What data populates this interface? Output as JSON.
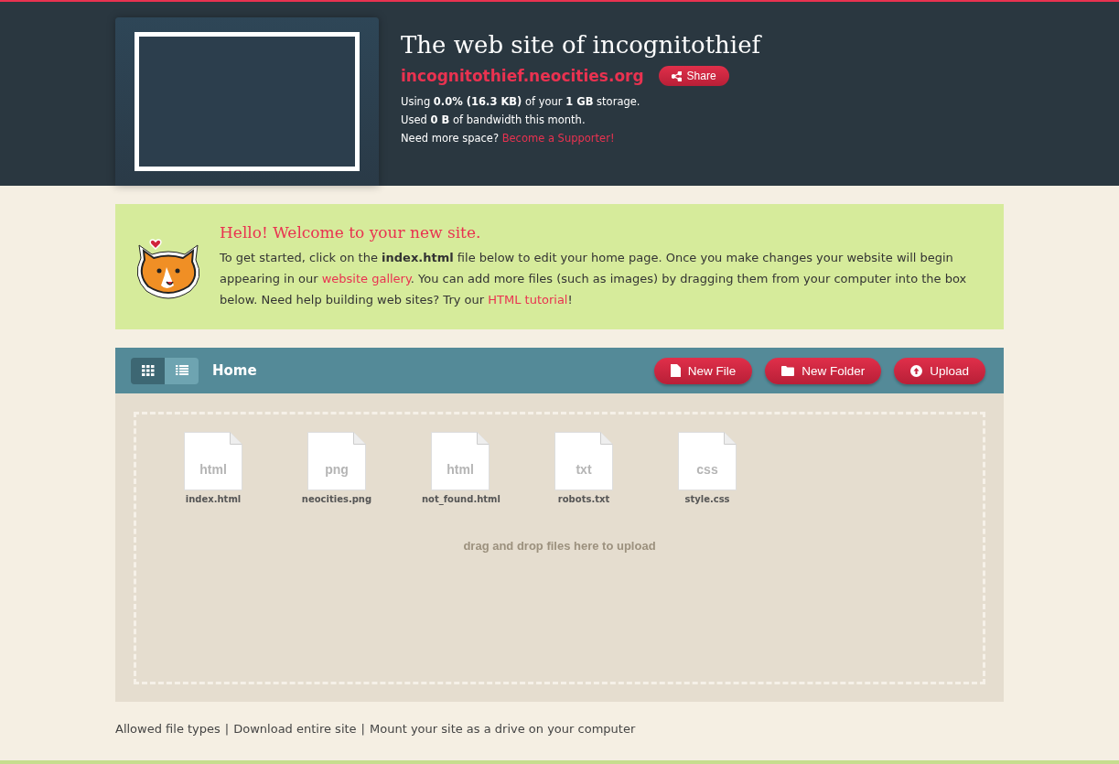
{
  "site": {
    "title": "The web site of incognitothief",
    "domain": "incognitothief.neocities.org",
    "share": "Share",
    "stats": [
      "Using **0.0% (16.3 KB)** of your **1 GB** storage.",
      "Used **0 B** of bandwidth this month."
    ],
    "more_space": "Need more space?",
    "supporter_link": "Become a Supporter!"
  },
  "welcome": {
    "heading": "Hello! Welcome to your new site.",
    "parts": [
      {
        "kind": "text",
        "text": "To get started, click on the **index.html** file below to edit your home page. Once you make changes your website will begin appearing in our "
      },
      {
        "kind": "link",
        "text": "website gallery"
      },
      {
        "kind": "text",
        "text": ". You can add more files (such as images) by dragging them from your computer into the box below. Need help building web sites? Try our "
      },
      {
        "kind": "link",
        "text": "HTML tutorial"
      },
      {
        "kind": "text",
        "text": "!"
      }
    ]
  },
  "toolbar": {
    "views": [
      {
        "kind": "grid",
        "selected": true
      },
      {
        "kind": "list",
        "selected": false
      }
    ],
    "path": "Home",
    "buttons": [
      {
        "kind": "file",
        "label": "New File"
      },
      {
        "kind": "folder",
        "label": "New Folder"
      },
      {
        "kind": "upload",
        "label": "Upload"
      }
    ]
  },
  "files": [
    {
      "ext": "html",
      "name": "index.html"
    },
    {
      "ext": "png",
      "name": "neocities.png"
    },
    {
      "ext": "html",
      "name": "not_found.html"
    },
    {
      "ext": "txt",
      "name": "robots.txt"
    },
    {
      "ext": "css",
      "name": "style.css"
    }
  ],
  "drop_hint": "drag and drop files here to upload",
  "footer_links": [
    "Allowed file types",
    "Download entire site",
    "Mount your site as a drive on your computer"
  ],
  "footer_separator": "|"
}
